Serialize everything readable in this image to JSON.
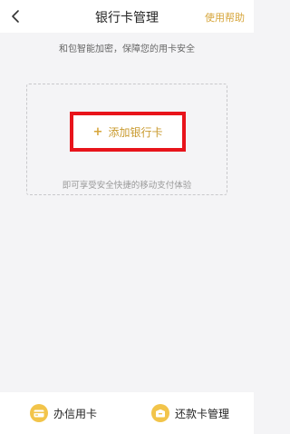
{
  "header": {
    "title": "银行卡管理",
    "help_label": "使用帮助"
  },
  "subtitle": "和包智能加密，保障您的用卡安全",
  "card_area": {
    "add_plus": "+",
    "add_label": "添加银行卡",
    "hint": "即可享受安全快捷的移动支付体验"
  },
  "bottom_bar": {
    "credit_card_label": "办信用卡",
    "repayment_label": "还款卡管理"
  },
  "colors": {
    "accent": "#d6a53a",
    "highlight_border": "#e8141b",
    "icon_yellow": "#f2c44a"
  }
}
